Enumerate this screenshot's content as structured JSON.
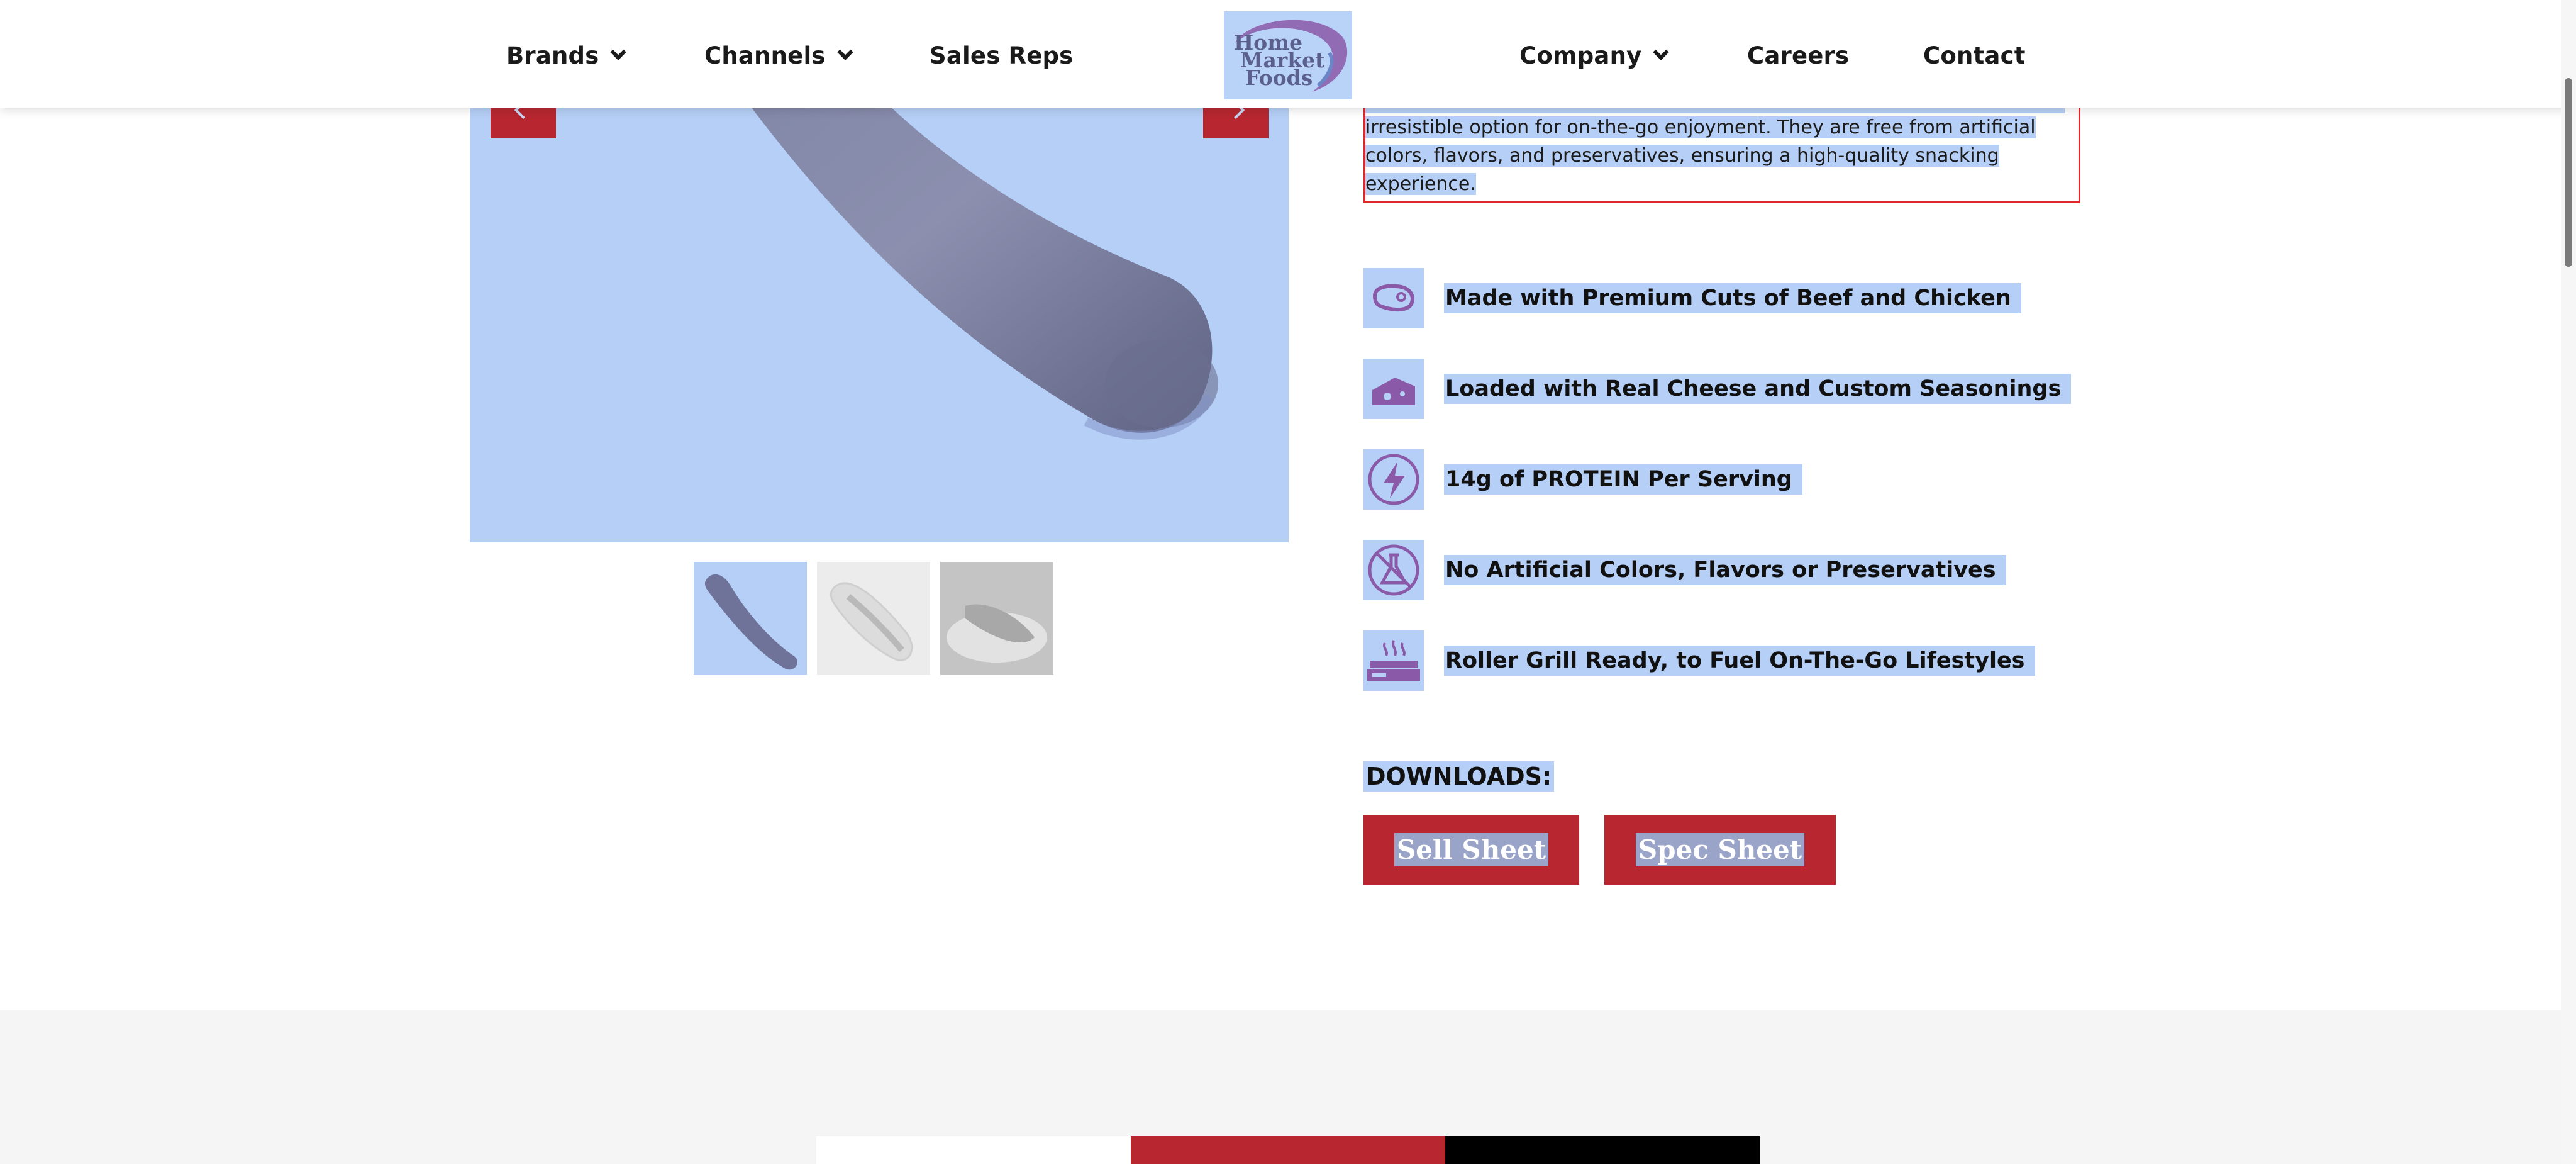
{
  "header": {
    "nav_left": [
      {
        "label": "Brands",
        "has_dropdown": true
      },
      {
        "label": "Channels",
        "has_dropdown": true
      },
      {
        "label": "Sales Reps",
        "has_dropdown": false
      }
    ],
    "logo": {
      "line1": "Home",
      "line2": "Market",
      "line3": "Foods"
    },
    "nav_right": [
      {
        "label": "Company",
        "has_dropdown": true
      },
      {
        "label": "Careers",
        "has_dropdown": false
      },
      {
        "label": "Contact",
        "has_dropdown": false
      }
    ]
  },
  "product": {
    "description_lines": [
      "irresistible option for on-the-go enjoyment. They are free from artificial",
      "colors, flavors, and preservatives, ensuring a high-quality snacking",
      "experience."
    ],
    "features": [
      {
        "icon": "steak-icon",
        "label": "Made with Premium Cuts of Beef and Chicken"
      },
      {
        "icon": "cheese-icon",
        "label": "Loaded with Real Cheese and Custom Seasonings"
      },
      {
        "icon": "lightning-bolt-icon",
        "label": "14g of PROTEIN Per Serving"
      },
      {
        "icon": "no-flask-icon",
        "label": "No Artificial Colors, Flavors or Preservatives"
      },
      {
        "icon": "roller-grill-icon",
        "label": "Roller Grill Ready, to Fuel On-The-Go Lifestyles"
      }
    ],
    "downloads": {
      "label": "DOWNLOADS:",
      "buttons": [
        "Sell Sheet",
        "Spec Sheet"
      ]
    }
  },
  "colors": {
    "brand_red": "#b8272f",
    "selection_blue": "#b6cff6",
    "logo_purple": "#7b4f9e",
    "focus_outline": "#e0282c"
  }
}
